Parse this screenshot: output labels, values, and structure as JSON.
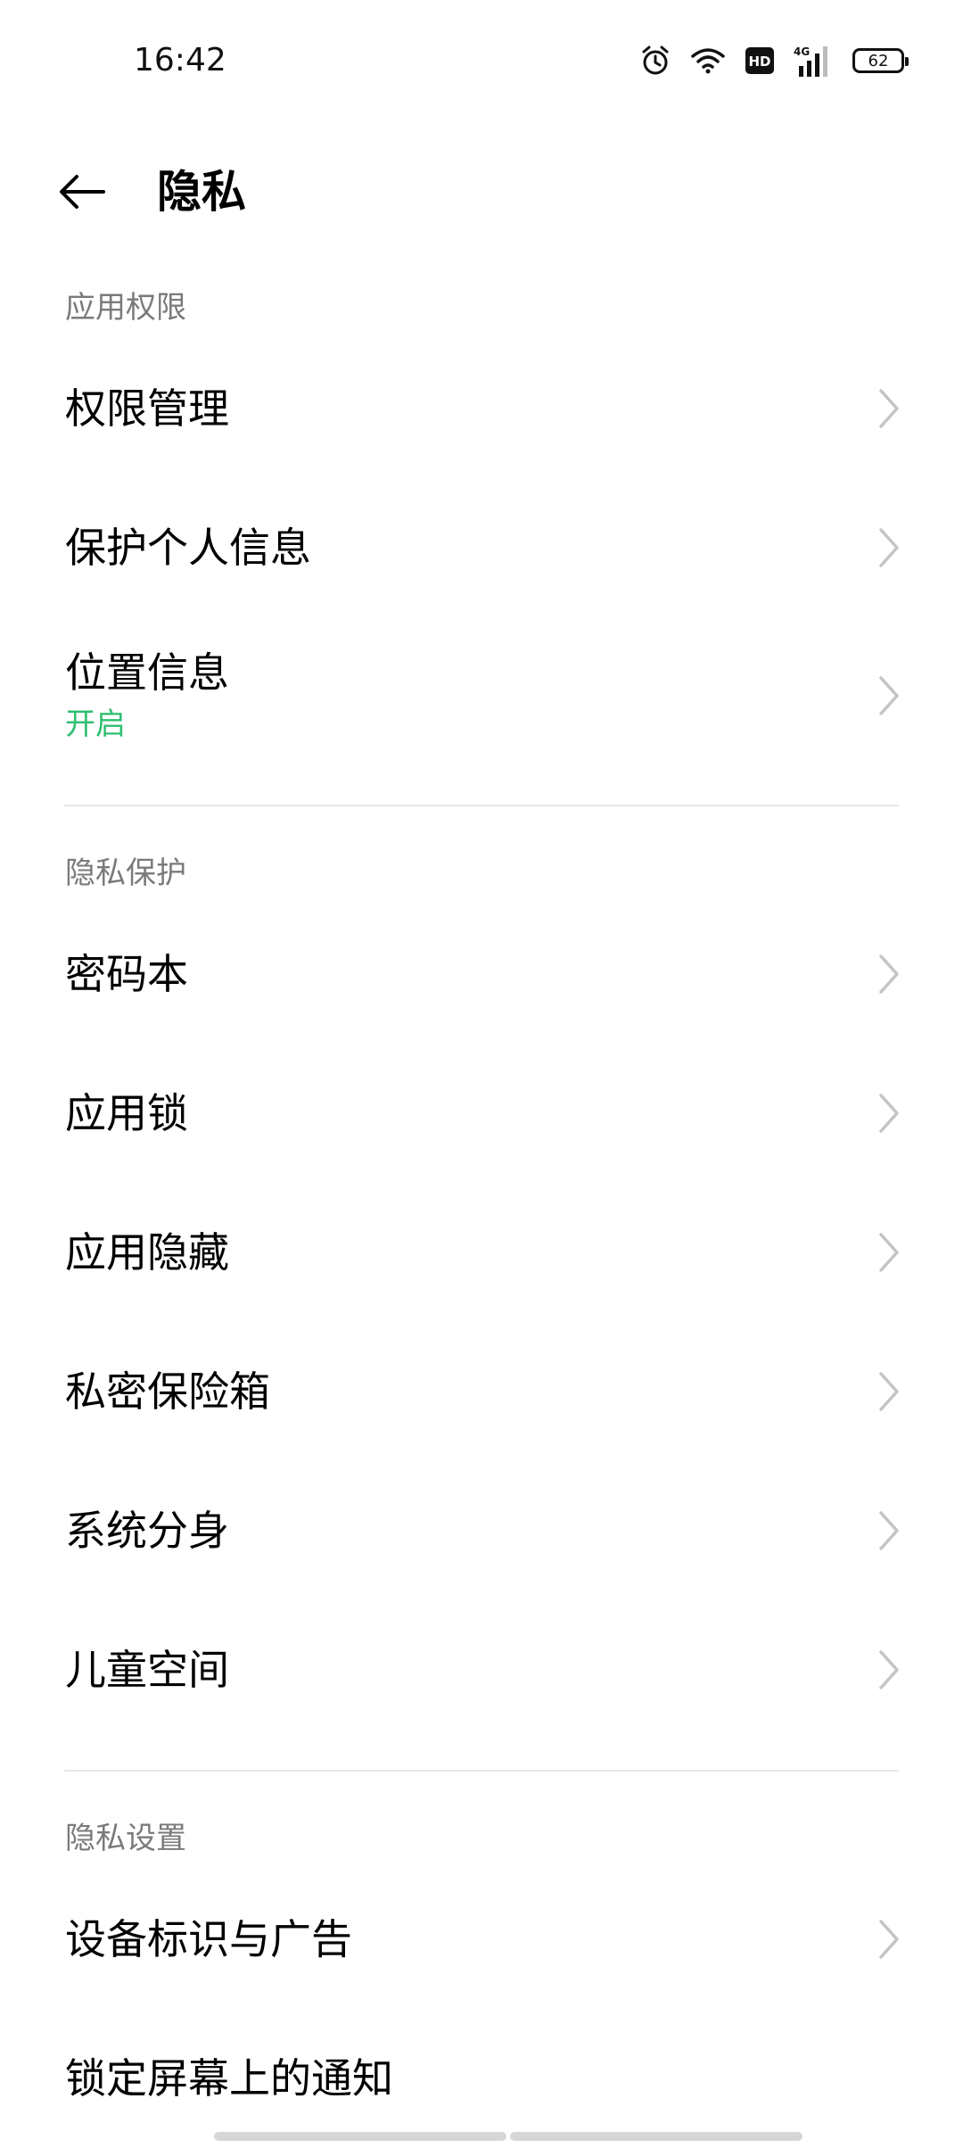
{
  "status_bar": {
    "time": "16:42",
    "network": "4G",
    "hd": "HD",
    "battery": "62",
    "icons": [
      "alarm-icon",
      "wifi-icon",
      "hd-icon",
      "signal-icon",
      "battery-icon"
    ]
  },
  "app_bar": {
    "title": "隐私",
    "back_icon": "back-arrow-icon"
  },
  "sections": [
    {
      "header": "应用权限",
      "items": [
        {
          "title": "权限管理"
        },
        {
          "title": "保护个人信息"
        },
        {
          "title": "位置信息",
          "subtitle": "开启"
        }
      ]
    },
    {
      "header": "隐私保护",
      "items": [
        {
          "title": "密码本"
        },
        {
          "title": "应用锁"
        },
        {
          "title": "应用隐藏"
        },
        {
          "title": "私密保险箱"
        },
        {
          "title": "系统分身"
        },
        {
          "title": "儿童空间"
        }
      ]
    },
    {
      "header": "隐私设置",
      "items": [
        {
          "title": "设备标识与广告"
        },
        {
          "title": "锁定屏幕上的通知"
        }
      ]
    }
  ],
  "colors": {
    "accent_green": "#2fbf71",
    "section_header": "#7a7a7a",
    "divider": "#e6e6e6",
    "chevron": "#c4c4c4"
  }
}
